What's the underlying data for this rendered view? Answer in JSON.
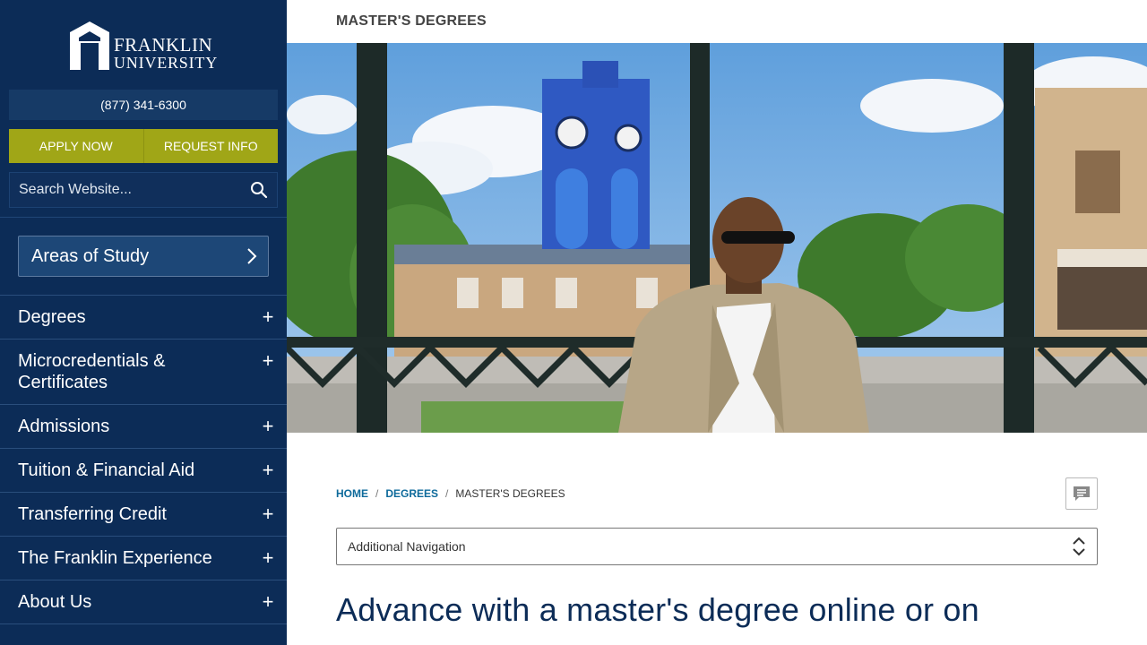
{
  "brand": {
    "logo_line1": "FRANKLIN",
    "logo_line2": "UNIVERSITY"
  },
  "sidebar": {
    "phone": "(877) 341-6300",
    "apply_label": "APPLY NOW",
    "request_label": "REQUEST INFO",
    "search_placeholder": "Search Website...",
    "areas_label": "Areas of Study",
    "nav_items": [
      {
        "label": "Degrees"
      },
      {
        "label": "Microcredentials & Certificates"
      },
      {
        "label": "Admissions"
      },
      {
        "label": "Tuition & Financial Aid"
      },
      {
        "label": "Transferring Credit"
      },
      {
        "label": "The Franklin Experience"
      },
      {
        "label": "About Us"
      }
    ],
    "expand_symbol": "+"
  },
  "header": {
    "title": "MASTER'S DEGREES"
  },
  "breadcrumb": {
    "home": "HOME",
    "degrees": "DEGREES",
    "current": "MASTER'S DEGREES",
    "separator": "/"
  },
  "additional_nav": {
    "selected": "Additional Navigation"
  },
  "main": {
    "headline": "Advance with a master's degree online or on"
  },
  "colors": {
    "sidebar": "#0c2c57",
    "cta": "#a0a617",
    "link": "#0e6a9b",
    "headline": "#0c2c57"
  },
  "icons": {
    "search": "search-icon",
    "chevron": "chevron-right-icon",
    "chat": "chat-icon",
    "select": "select-arrows-icon"
  }
}
